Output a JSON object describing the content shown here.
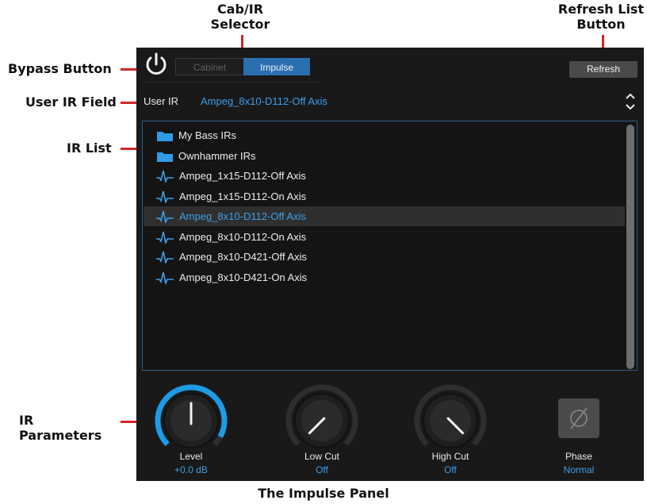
{
  "callouts": {
    "cab_ir_selector": "Cab/IR\nSelector",
    "refresh_list_button": "Refresh List\nButton",
    "bypass_button": "Bypass Button",
    "user_ir_field": "User IR Field",
    "ir_list": "IR List",
    "ir_parameters": "IR Parameters"
  },
  "caption": "The Impulse Panel",
  "selector": {
    "cabinet_label": "Cabinet",
    "impulse_label": "Impulse",
    "selected": "Impulse"
  },
  "refresh_label": "Refresh",
  "user_ir": {
    "label": "User IR",
    "value": "Ampeg_8x10-D112-Off Axis"
  },
  "ir_list": {
    "folders": [
      "My Bass IRs",
      "Ownhammer IRs"
    ],
    "files": [
      "Ampeg_1x15-D112-Off Axis",
      "Ampeg_1x15-D112-On Axis",
      "Ampeg_8x10-D112-Off Axis",
      "Ampeg_8x10-D112-On Axis",
      "Ampeg_8x10-D421-Off Axis",
      "Ampeg_8x10-D421-On Axis"
    ],
    "selected_file": "Ampeg_8x10-D112-Off Axis"
  },
  "parameters": {
    "level": {
      "label": "Level",
      "value": "+0.0 dB",
      "knob_fraction": 0.5,
      "ring_color": "#1d9be6"
    },
    "low_cut": {
      "label": "Low Cut",
      "value": "Off",
      "knob_fraction": 0.0
    },
    "high_cut": {
      "label": "High Cut",
      "value": "Off",
      "knob_fraction": 1.0
    },
    "phase": {
      "label": "Phase",
      "value": "Normal",
      "icon": "phase-invert-icon"
    }
  },
  "colors": {
    "accent": "#3d9fe8",
    "callout_line": "#d32525",
    "panel_bg": "#191919"
  }
}
